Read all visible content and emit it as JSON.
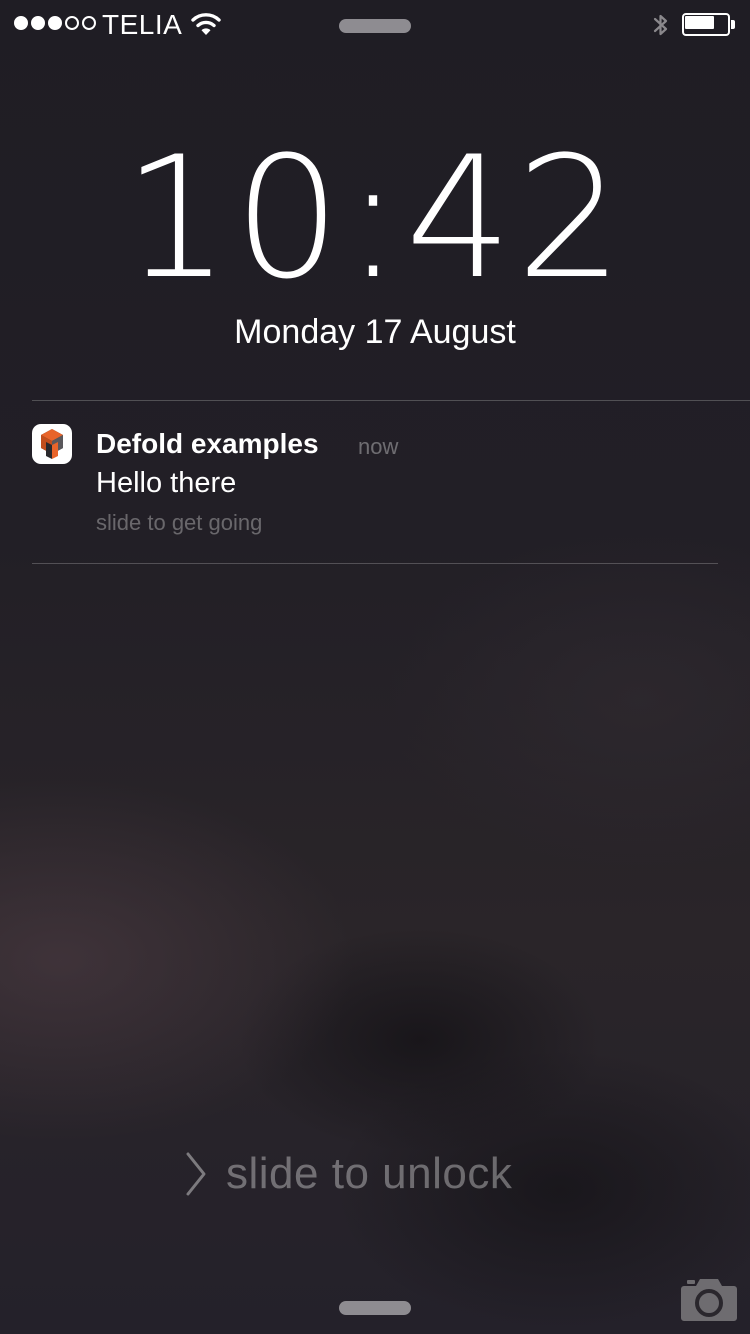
{
  "status_bar": {
    "signal_strength": 3,
    "signal_max": 5,
    "carrier": "TELIA",
    "wifi_icon": "wifi-icon",
    "bluetooth_icon": "bluetooth-icon",
    "battery_level": 0.7
  },
  "lock_screen": {
    "time": "10:42",
    "date": "Monday 17 August"
  },
  "notification": {
    "app_icon": "defold-app-icon",
    "app_name": "Defold examples",
    "time": "now",
    "message": "Hello there",
    "action_hint": "slide to get going"
  },
  "bottom": {
    "unlock_label": "slide to unlock",
    "chevron_icon": "chevron-right-icon",
    "camera_icon": "camera-icon"
  },
  "colors": {
    "background": "#211e25",
    "text": "#ffffff",
    "grabber": "#8e8c91",
    "icon_orange": "#e8642a"
  }
}
